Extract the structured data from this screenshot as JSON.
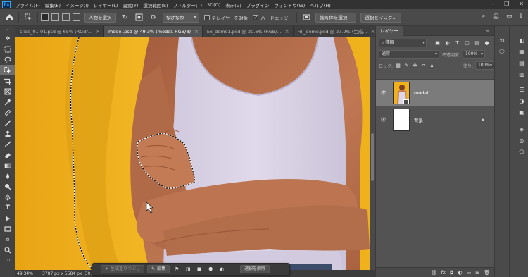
{
  "app": {
    "logo": "Ps",
    "menu": [
      "ファイル(F)",
      "編集(E)",
      "イメージ(I)",
      "レイヤー(L)",
      "書式(Y)",
      "選択範囲(S)",
      "フィルター(T)",
      "3D(D)",
      "表示(V)",
      "プラグイン",
      "ウィンドウ(W)",
      "ヘルプ(H)"
    ]
  },
  "options_bar": {
    "subject_select_label": "人物を選択",
    "sample_select_value": "なげなわ",
    "all_layers_label": "全レイヤーを対象",
    "all_layers_checked": false,
    "hard_edge_label": "ハードエッジ",
    "hard_edge_checked": true,
    "select_subject_btn": "被写体を選択",
    "select_and_mask_btn": "選択とマスク..."
  },
  "doc_tabs": [
    {
      "label": "slide_01-01.psd @ 65% (RGB/...",
      "active": false
    },
    {
      "label": "model.psd @ 49.3% (model, RGB/8)",
      "active": true
    },
    {
      "label": "Ex_demo1.psd @ 20.6% (RGB/...",
      "active": false
    },
    {
      "label": "Fill_demo.psd @ 27.9% (生成...",
      "active": false
    }
  ],
  "status": {
    "zoom": "49.34%",
    "dimensions": "3787 px x 5584 px (30..."
  },
  "taskbar": {
    "generative_fill": "生成塗りつぶし",
    "modify": "編集",
    "deselect": "選択を解除"
  },
  "layers_panel": {
    "tab_label": "レイヤー",
    "filter_kind": "種類",
    "blend_mode": "通常",
    "opacity_label": "不透明度:",
    "opacity_value": "100%",
    "lock_label": "ロック:",
    "fill_label": "塗り:",
    "fill_value": "100%",
    "layers": [
      {
        "name": "model",
        "selected": true,
        "locked": false
      },
      {
        "name": "背景",
        "selected": false,
        "locked": true
      }
    ]
  },
  "colors": {
    "canvas_bg": "#f0b21c",
    "skin": "#b87150",
    "shirt": "#dad3e5",
    "panel": "#535353",
    "selected_layer": "#7b7b7b"
  }
}
